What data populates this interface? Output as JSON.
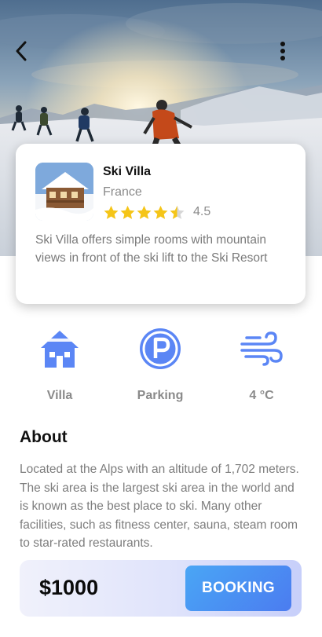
{
  "header": {
    "back_icon": "chevron-left-icon",
    "more_icon": "more-vertical-icon"
  },
  "property": {
    "name": "Ski Villa",
    "location": "France",
    "rating": 4.5,
    "rating_text": "4.5",
    "rating_max": 5,
    "description": "Ski Villa offers simple rooms with mountain views in front of the ski lift to the Ski Resort"
  },
  "amenities": [
    {
      "icon": "house-icon",
      "label": "Villa"
    },
    {
      "icon": "parking-icon",
      "label": "Parking"
    },
    {
      "icon": "wind-icon",
      "label": "4 °C"
    }
  ],
  "about": {
    "title": "About",
    "text": "Located at the Alps with an altitude of 1,702 meters. The ski area is the largest ski area in the world and is known as the best place to ski. Many other facilities, such as fitness center, sauna, steam room to star-rated restaurants."
  },
  "booking": {
    "price": "$1000",
    "button_label": "BOOKING"
  },
  "colors": {
    "accent_blue": "#4b7cf0",
    "amenity_icon": "#5b86f5",
    "star": "#f5c518",
    "star_empty": "#d6d6d6"
  }
}
